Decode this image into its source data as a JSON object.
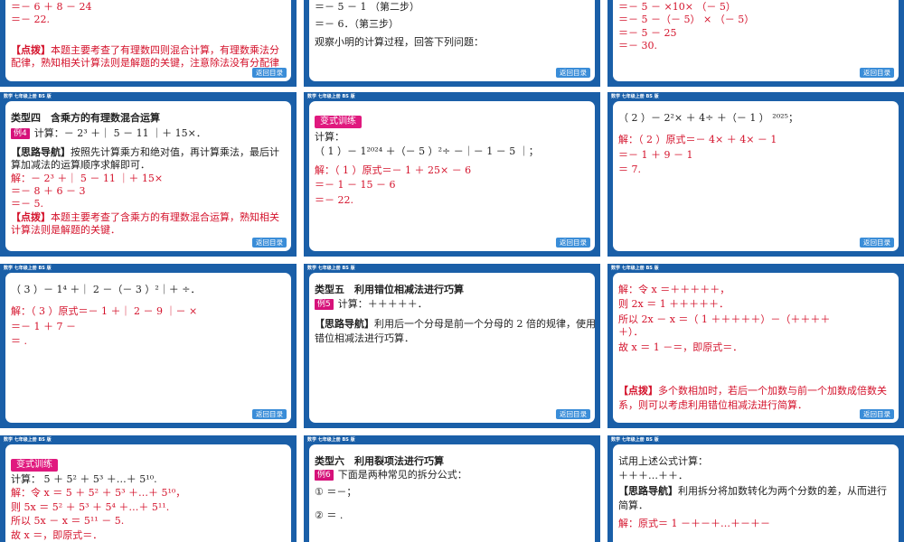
{
  "header_text": "数学 七年级上册 BS 版",
  "back_label": "返回目录",
  "slide1": {
    "lines": [
      "＝－ 6 ＋ 8 － 24",
      "＝－ 22."
    ],
    "tip_tag": "【点拨】",
    "tip_line1": "本题主要考查了有理数四则混合计算，有理数乘法分",
    "tip_line2": "配律，熟知相关计算法则是解题的关键，注意除法没有分配律"
  },
  "slide2": {
    "line1": "＝－ 5 － 1 （第二步）",
    "line2": "＝－ 6．（第三步）",
    "line3": "观察小明的计算过程，回答下列问题："
  },
  "slide3": {
    "lines": [
      "＝－ 5 － ×10× （－ 5）",
      "＝－ 5 －（－ 5） × （－ 5）",
      "＝－ 5 － 25",
      "＝－ 30."
    ]
  },
  "slide4": {
    "title": "类型四　含乘方的有理数混合运算",
    "example_tag": "例4",
    "problem": "计算：－ 2³ ＋｜ 5 － 11 ｜＋ 15×．",
    "hint_tag": "【思路导航】",
    "hint_line1": "按照先计算乘方和绝对值，再计算乘法，最后计",
    "hint_line2": "算加减法的运算顺序求解即可．",
    "sol_line1": "解：－ 2³ ＋｜ 5 － 11 ｜＋ 15×",
    "sol_line2": "＝－ 8 ＋ 6 － 3",
    "sol_line3": "＝－ 5.",
    "tip_tag": "【点拨】",
    "tip_line1": "本题主要考查了含乘方的有理数混合运算，熟知相关",
    "tip_line2": "计算法则是解题的关键．"
  },
  "slide5": {
    "badge": "变式训练",
    "line1": "计算：",
    "line2": "（ 1 ）－ 1²⁰²⁴ ＋（－ 5 ）²÷ －｜－ 1 － 5 ｜；",
    "sol_line1": "解：（ 1 ）原式＝－ 1 ＋ 25× － 6",
    "sol_line2": "＝－ 1 － 15 － 6",
    "sol_line3": "＝－ 22."
  },
  "slide6": {
    "line1": "（ 2 ）－ 2²× ＋ 4÷ ＋（－ 1 ） ²⁰²⁵；",
    "sol_line1": "解：（ 2 ）原式＝－ 4× ＋ 4× － 1",
    "sol_line2": "＝－ 1 ＋ 9 － 1",
    "sol_line3": "＝ 7."
  },
  "slide7": {
    "line1": "（ 3 ）－ 1⁴ ＋｜ 2 －（－ 3 ）²｜＋ ÷．",
    "sol_line1": "解：（ 3 ）原式＝－ 1 ＋｜ 2 － 9 ｜－ ×",
    "sol_line2": "＝－ 1 ＋ 7 －",
    "sol_line3": "＝ ."
  },
  "slide8": {
    "title": "类型五　利用错位相减法进行巧算",
    "example_tag": "例5",
    "problem": "计算：＋＋＋＋＋．",
    "hint_tag": "【思路导航】",
    "hint_line1": "利用后一个分母是前一个分母的 2 倍的规律，使用",
    "hint_line2": "错位相减法进行巧算．"
  },
  "slide9": {
    "sol_line1": "解：令 x ＝＋＋＋＋＋，",
    "sol_line2": "则 2x ＝ 1 ＋＋＋＋＋．",
    "sol_line3": "所以 2x － x ＝（ 1 ＋＋＋＋＋）－（＋＋＋＋",
    "sol_line4": "＋）．",
    "sol_line5": "故 x ＝ 1 －＝，即原式＝．",
    "tip_tag": "【点拨】",
    "tip_line1": "多个数相加时，若后一个加数与前一个加数成倍数关",
    "tip_line2": "系，则可以考虑利用错位相减法进行简算．"
  },
  "slide10": {
    "badge": "变式训练",
    "line1": "计算： 5 ＋ 5² ＋ 5³ ＋…＋ 5¹⁰.",
    "sol_line1": "解：令 x ＝ 5 ＋ 5² ＋ 5³ ＋…＋ 5¹⁰，",
    "sol_line2": "则 5x ＝ 5² ＋ 5³ ＋ 5⁴ ＋…＋ 5¹¹.",
    "sol_line3": "所以 5x － x ＝ 5¹¹ － 5.",
    "sol_line4": "故 x ＝，即原式＝．"
  },
  "slide11": {
    "title": "类型六　利用裂项法进行巧算",
    "example_tag": "例6",
    "line1": "下面是两种常见的拆分公式：",
    "line2": "① ＝－；",
    "line3": "② ＝ ."
  },
  "slide12": {
    "line1": "试用上述公式计算：",
    "line2": "＋＋＋…＋＋．",
    "hint_tag": "【思路导航】",
    "hint_line1": "利用拆分将加数转化为两个分数的差，从而进行",
    "hint_line2": "简算．",
    "sol_line1": "解：原式＝ 1 －＋－＋…＋－＋－"
  }
}
